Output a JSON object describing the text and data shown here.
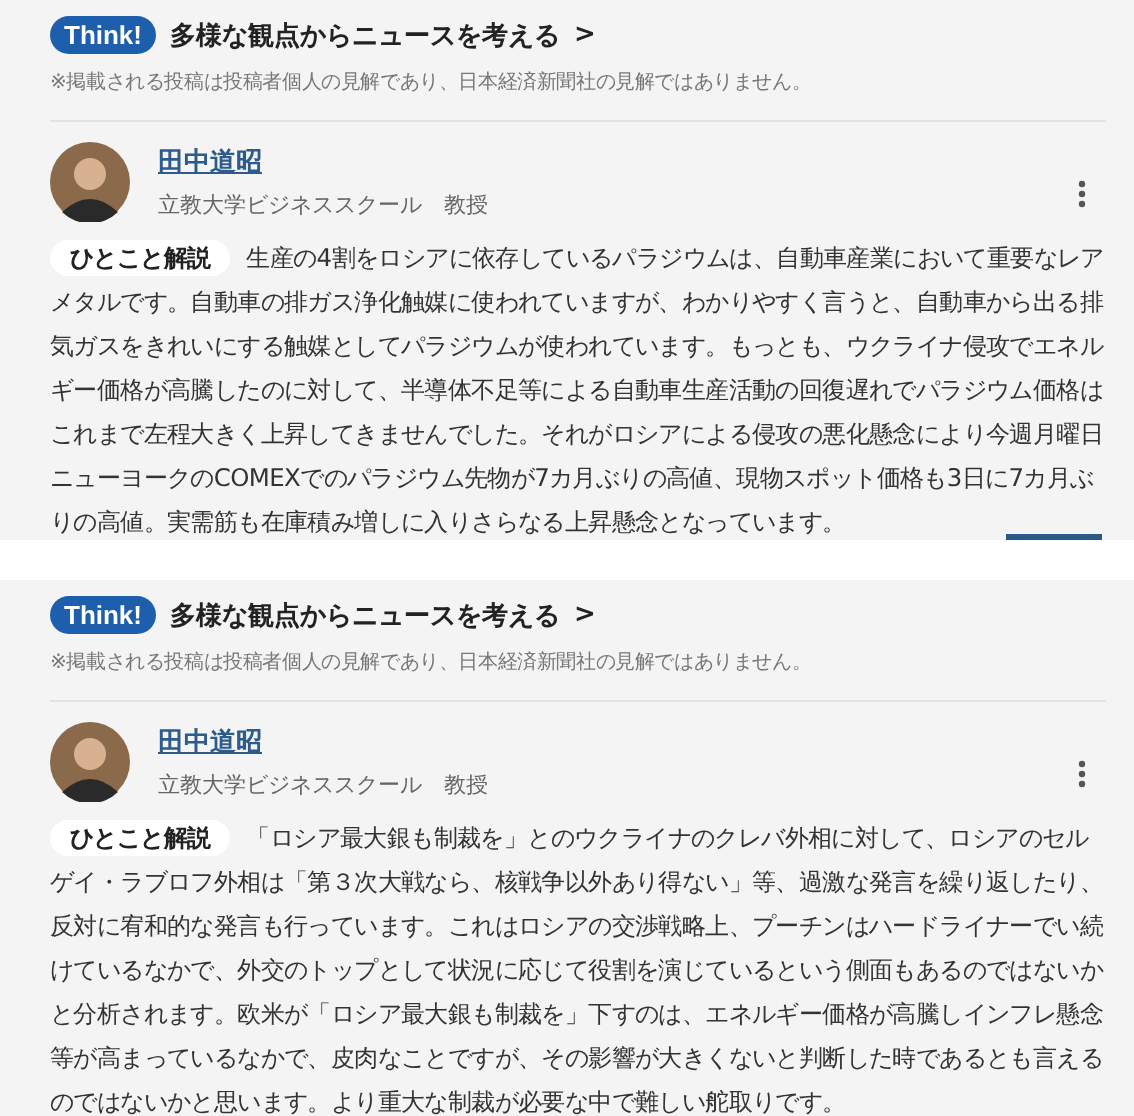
{
  "posts": [
    {
      "badge": "Think!",
      "heading": "多様な観点からニュースを考える",
      "chevron": ">",
      "disclaimer": "※掲載される投稿は投稿者個人の見解であり、日本経済新聞社の見解ではありません。",
      "author": {
        "name": "田中道昭",
        "affiliation": "立教大学ビジネススクール　教授"
      },
      "label": "ひとこと解説",
      "text": "生産の4割をロシアに依存しているパラジウムは、自動車産業において重要なレアメタルです。自動車の排ガス浄化触媒に使われていますが、わかりやすく言うと、自動車から出る排気ガスをきれいにする触媒としてパラジウムが使われています。もっとも、ウクライナ侵攻でエネルギー価格が高騰したのに対して、半導体不足等による自動車生産活動の回復遅れでパラジウム価格はこれまで左程大きく上昇してきませんでした。それがロシアによる侵攻の悪化懸念により今週月曜日ニューヨークのCOMEXでのパラジウム先物が7カ月ぶりの高値、現物スポット価格も3日に7カ月ぶりの高値。実需筋も在庫積み増しに入りさらなる上昇懸念となっています。",
      "accent_bar": true
    },
    {
      "badge": "Think!",
      "heading": "多様な観点からニュースを考える",
      "chevron": ">",
      "disclaimer": "※掲載される投稿は投稿者個人の見解であり、日本経済新聞社の見解ではありません。",
      "author": {
        "name": "田中道昭",
        "affiliation": "立教大学ビジネススクール　教授"
      },
      "label": "ひとこと解説",
      "text": "「ロシア最大銀も制裁を」とのウクライナのクレバ外相に対して、ロシアのセルゲイ・ラブロフ外相は「第３次大戦なら、核戦争以外あり得ない」等、過激な発言を繰り返したり、反対に宥和的な発言も行っています。これはロシアの交渉戦略上、プーチンはハードライナーでい続けているなかで、外交のトップとして状況に応じて役割を演じているという側面もあるのではないかと分析されます。欧米が「ロシア最大銀も制裁を」下すのは、エネルギー価格が高騰しインフレ懸念等が高まっているなかで、皮肉なことですが、その影響が大きくないと判断した時であるとも言えるのではないかと思います。より重大な制裁が必要な中で難しい舵取りです。",
      "accent_bar": false
    }
  ]
}
